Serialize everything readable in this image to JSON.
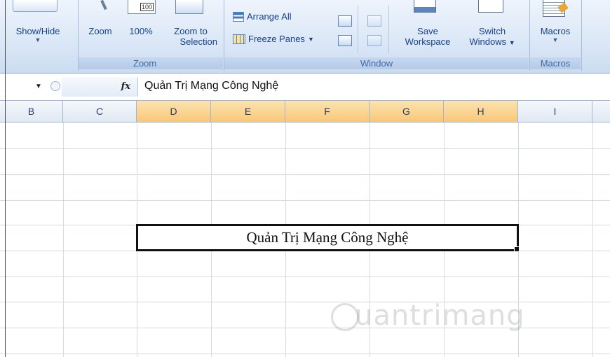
{
  "ribbon": {
    "groups": {
      "zoom_label": "Zoom",
      "window_label": "Window",
      "macros_label": "Macros"
    },
    "show_hide": "Show/Hide",
    "zoom": "Zoom",
    "hundred_percent": "100%",
    "zoom_to_selection_l1": "Zoom to",
    "zoom_to_selection_l2": "Selection",
    "arrange_all": "Arrange All",
    "freeze_panes": "Freeze Panes",
    "save_workspace_l1": "Save",
    "save_workspace_l2": "Workspace",
    "switch_windows_l1": "Switch",
    "switch_windows_l2": "Windows",
    "macros": "Macros",
    "hundred_badge": "100"
  },
  "formula_bar": {
    "fx": "fx",
    "content": "Quản Trị Mạng Công Nghệ"
  },
  "columns": [
    "B",
    "C",
    "D",
    "E",
    "F",
    "G",
    "H",
    "I"
  ],
  "selected_columns": [
    "D",
    "E",
    "F",
    "G",
    "H"
  ],
  "cell": {
    "value": "Quản Trị Mạng Công Nghệ"
  },
  "watermark": "uantrimang",
  "colors": {
    "ribbon_text": "#15428b",
    "selected_header": "#f8c878",
    "grid_line": "#d3dae4"
  }
}
